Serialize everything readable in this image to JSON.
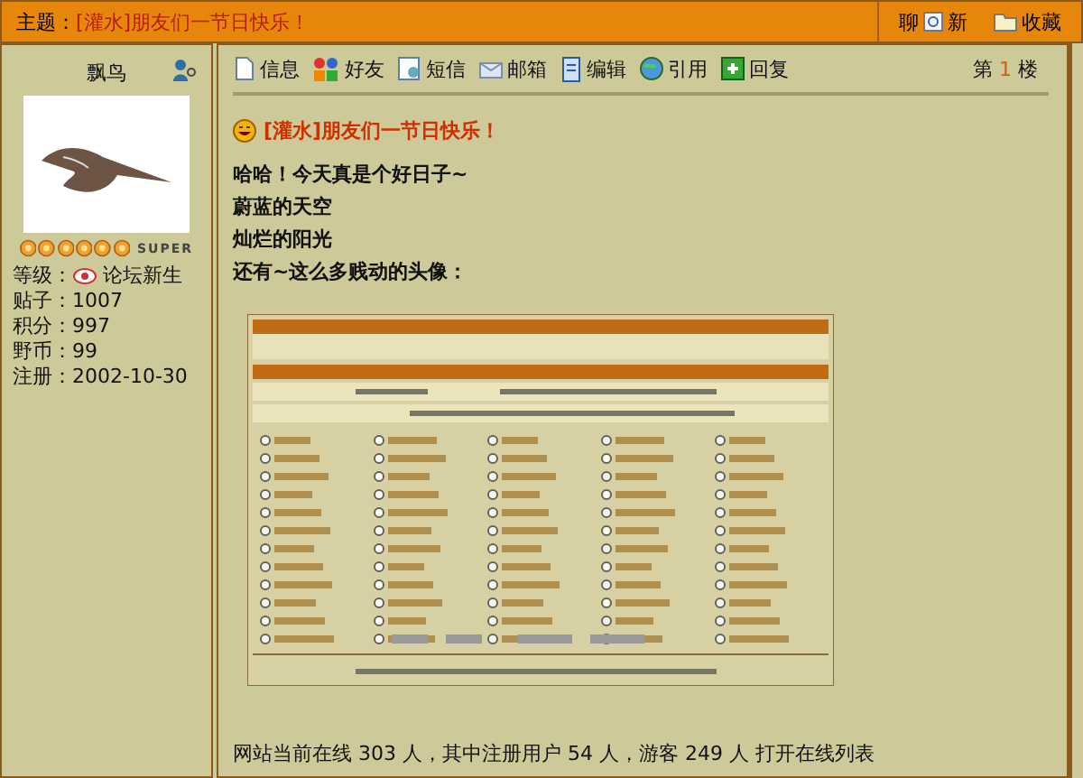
{
  "topic": {
    "label": "主题：",
    "title": "[灌水]朋友们一节日快乐！"
  },
  "top_actions": [
    {
      "kind": "refresh",
      "text_before": "聊",
      "text_after": "新"
    },
    {
      "kind": "favorite",
      "text_after": "收藏"
    }
  ],
  "user": {
    "name": "飘鸟",
    "stars": 6,
    "rank_badge": "SUPER",
    "stats": [
      {
        "label": "等级：",
        "value": "论坛新生",
        "kind": "level"
      },
      {
        "label": "贴子：",
        "value": "1007",
        "kind": "plain"
      },
      {
        "label": "积分：",
        "value": "997",
        "kind": "plain"
      },
      {
        "label": "野币：",
        "value": "99",
        "kind": "plain"
      },
      {
        "label": "注册：",
        "value": "2002-10-30",
        "kind": "plain"
      }
    ]
  },
  "toolbar": [
    {
      "kind": "info",
      "label": "信息"
    },
    {
      "kind": "friend",
      "label": "好友"
    },
    {
      "kind": "message",
      "label": "短信"
    },
    {
      "kind": "mail",
      "label": "邮箱"
    },
    {
      "kind": "edit",
      "label": "编辑"
    },
    {
      "kind": "quote",
      "label": "引用"
    },
    {
      "kind": "reply",
      "label": "回复"
    }
  ],
  "floor": {
    "before": "第",
    "number": "1",
    "after": "楼"
  },
  "post": {
    "title": "[灌水]朋友们一节日快乐！",
    "lines": [
      "哈哈！今天真是个好日子~",
      "蔚蓝的天空",
      "灿烂的阳光",
      "还有~这么多贱动的头像："
    ]
  },
  "online_line": "网站当前在线 303 人，其中注册用户 54 人，游客 249 人  打开在线列表"
}
